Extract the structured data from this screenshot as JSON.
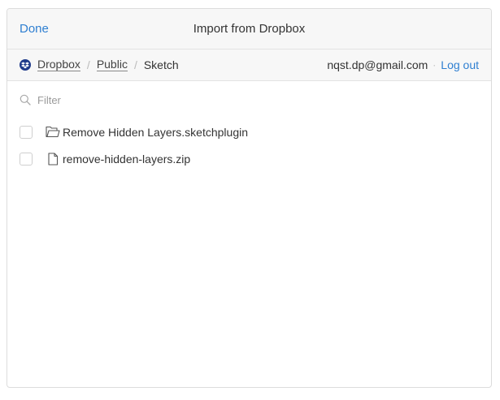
{
  "header": {
    "done_label": "Done",
    "title": "Import from Dropbox"
  },
  "breadcrumb": {
    "items": [
      {
        "label": "Dropbox",
        "link": true
      },
      {
        "label": "Public",
        "link": true
      },
      {
        "label": "Sketch",
        "link": false
      }
    ],
    "separator": "/"
  },
  "account": {
    "email": "nqst.dp@gmail.com",
    "separator": "·",
    "logout_label": "Log out"
  },
  "filter": {
    "placeholder": "Filter",
    "value": ""
  },
  "files": [
    {
      "name": "Remove Hidden Layers.sketchplugin",
      "icon": "folder-icon",
      "checked": false
    },
    {
      "name": "remove-hidden-layers.zip",
      "icon": "file-icon",
      "checked": false
    }
  ],
  "colors": {
    "accent": "#2f7fd1",
    "dropbox_brand": "#1f3a8a",
    "text": "#333333"
  }
}
